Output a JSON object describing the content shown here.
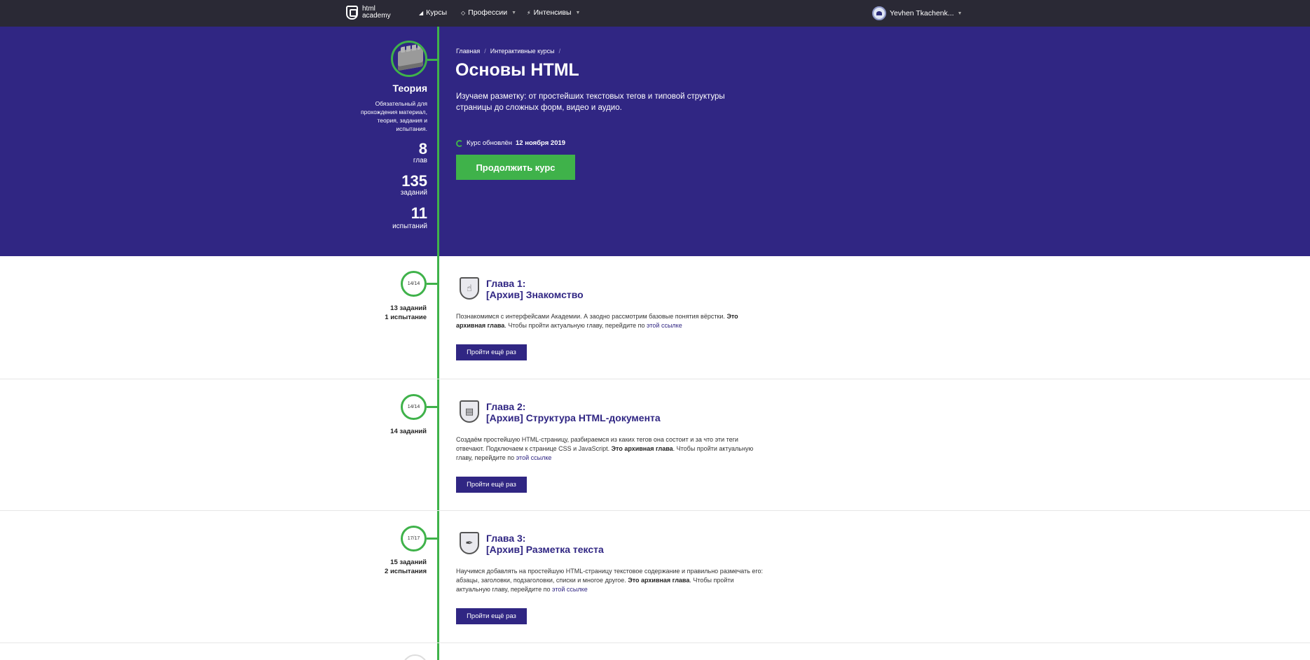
{
  "nav": {
    "logo_text": "html academy",
    "items": [
      {
        "label": "Курсы",
        "icon": "chart-icon",
        "has_caret": false
      },
      {
        "label": "Профессии",
        "icon": "diamond-icon",
        "has_caret": true
      },
      {
        "label": "Интенсивы",
        "icon": "bolt-icon",
        "has_caret": true
      }
    ],
    "user_name": "Yevhen Tkachenk..."
  },
  "hero_left": {
    "title": "Теория",
    "description": "Обязательный для прохождения материал, теория, задания и испытания.",
    "stats": [
      {
        "value": "8",
        "label": "глав"
      },
      {
        "value": "135",
        "label": "заданий"
      },
      {
        "value": "11",
        "label": "испытаний"
      }
    ]
  },
  "breadcrumb": [
    "Главная",
    "Интерактивные курсы"
  ],
  "course": {
    "title": "Основы HTML",
    "description": "Изучаем разметку: от простейших текстовых тегов и типовой структуры страницы до сложных форм, видео и аудио.",
    "updated_prefix": "Курс обновлён",
    "updated_date": "12 ноября 2019",
    "continue_label": "Продолжить курс"
  },
  "chapters": [
    {
      "progress": "14/14",
      "stats_line1": "13 заданий",
      "stats_line2": "1 испытание",
      "title_line1": "Глава 1:",
      "title_line2": "[Архив] Знакомство",
      "icon": "hand-icon",
      "desc_plain": "Познакомимся с интерфейсами Академии. А заодно рассмотрим базовые понятия вёрстки.",
      "desc_bold": "Это архивная глава",
      "desc_rest": ". Чтобы пройти актуальную главу, перейдите по",
      "desc_link": "этой ссылке",
      "button": "Пройти ещё раз"
    },
    {
      "progress": "14/14",
      "stats_line1": "14 заданий",
      "stats_line2": "",
      "title_line1": "Глава 2:",
      "title_line2": "[Архив] Структура HTML-документа",
      "icon": "document-icon",
      "desc_plain": "Создаём простейшую HTML-страницу, разбираемся из каких тегов она состоит и за что эти теги отвечают. Подключаем к странице CSS и JavaScript.",
      "desc_bold": "Это архивная глава",
      "desc_rest": ". Чтобы пройти актуальную главу, перейдите по",
      "desc_link": "этой ссылке",
      "button": "Пройти ещё раз"
    },
    {
      "progress": "17/17",
      "stats_line1": "15 заданий",
      "stats_line2": "2 испытания",
      "title_line1": "Глава 3:",
      "title_line2": "[Архив] Разметка текста",
      "icon": "pen-nib-icon",
      "desc_plain": "Научимся добавлять на простейшую HTML-страницу текстовое содержание и правильно размечать его: абзацы, заголовки, подзаголовки, списки и многое другое.",
      "desc_bold": "Это архивная глава",
      "desc_rest": ". Чтобы пройти актуальную главу, перейдите по",
      "desc_link": "этой ссылке",
      "button": "Пройти ещё раз"
    }
  ],
  "colors": {
    "nav_bg": "#2a2935",
    "hero_bg": "#302683",
    "accent_green": "#3fb24a",
    "button_purple": "#302683"
  }
}
